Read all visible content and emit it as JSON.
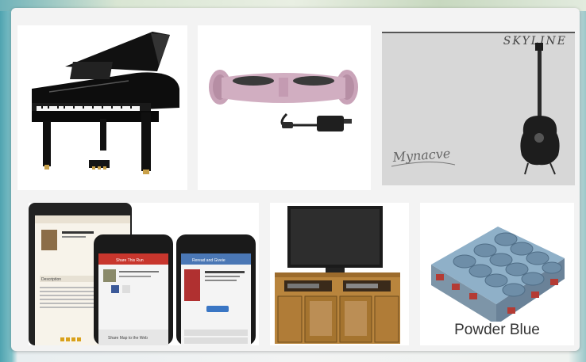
{
  "products": {
    "piano": {
      "name": "piano-image"
    },
    "hoverboard": {
      "name": "hoverboard-image"
    },
    "guitar": {
      "brand": "SKYLINE",
      "signature": "Mynacve"
    },
    "phones": {
      "header_one": "Share This Run",
      "header_two": "Reread and Giveie",
      "section": "Description",
      "share_label": "Share Map to the Web"
    },
    "tv": {
      "name": "tv-stand-image"
    },
    "chalk": {
      "label": "Powder Blue"
    }
  },
  "colors": {
    "panel": "#f3f3f3",
    "hoverboard_pink": "#c9a3b8",
    "chalk_blue": "#6e8ea8",
    "wood": "#b9853d",
    "phone_red": "#c8362d"
  }
}
